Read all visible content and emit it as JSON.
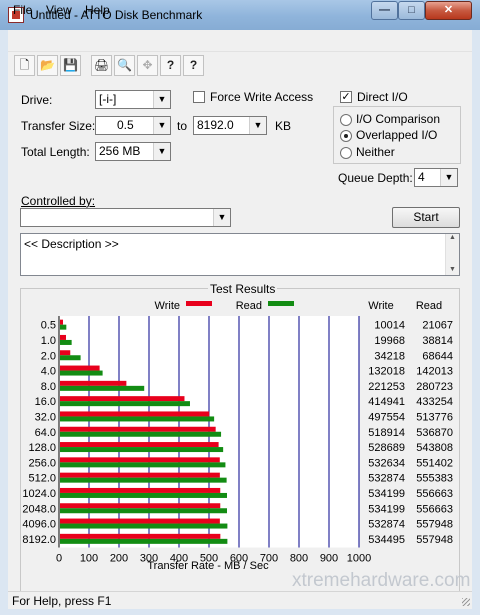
{
  "window": {
    "title": "Untitled - ATTO Disk Benchmark",
    "min": "—",
    "max": "□",
    "close": "✕"
  },
  "menu": [
    "File",
    "View",
    "Help"
  ],
  "toolbar": {
    "icons": [
      "new-document-icon",
      "open-folder-icon",
      "save-icon",
      "print-icon",
      "print-preview-icon",
      "move-icon",
      "help-icon",
      "context-help-icon"
    ],
    "glyphs": [
      "🗋",
      "📂",
      "💾",
      "🖨",
      "🔍",
      "✥",
      "?",
      "?"
    ]
  },
  "settings": {
    "drive_label": "Drive:",
    "drive_value": "[-i-]",
    "transfer_size_label": "Transfer Size:",
    "transfer_from": "0.5",
    "to_label": "to",
    "transfer_to": "8192.0",
    "unit": "KB",
    "total_length_label": "Total Length:",
    "total_length": "256 MB",
    "force_write_access_label": "Force Write Access",
    "force_write_access": false,
    "direct_io_label": "Direct I/O",
    "direct_io": true,
    "io_options": [
      {
        "label": "I/O Comparison",
        "selected": false
      },
      {
        "label": "Overlapped I/O",
        "selected": true
      },
      {
        "label": "Neither",
        "selected": false
      }
    ],
    "queue_depth_label": "Queue Depth:",
    "queue_depth": "4",
    "controlled_by_label": "Controlled by:",
    "controlled_by": "",
    "start_label": "Start",
    "description": "<< Description >>"
  },
  "results": {
    "title": "Test Results",
    "legend_write": "Write",
    "legend_read": "Read",
    "write_header": "Write",
    "read_header": "Read",
    "x_axis_label": "Transfer Rate - MB / Sec"
  },
  "colors": {
    "write": "#e8001c",
    "read": "#138c13",
    "gridline": "#00008b"
  },
  "chart_data": {
    "type": "bar",
    "orientation": "horizontal",
    "title": "Test Results",
    "xlabel": "Transfer Rate - MB / Sec",
    "xlim": [
      0,
      1000
    ],
    "x_ticks": [
      "0",
      "100",
      "200",
      "300",
      "400",
      "500",
      "600",
      "700",
      "800",
      "900",
      "1000"
    ],
    "categories": [
      "0.5",
      "1.0",
      "2.0",
      "4.0",
      "8.0",
      "16.0",
      "32.0",
      "64.0",
      "128.0",
      "256.0",
      "512.0",
      "1024.0",
      "2048.0",
      "4096.0",
      "8192.0"
    ],
    "series": [
      {
        "name": "Write",
        "values": [
          10014,
          19968,
          34218,
          132018,
          221253,
          414941,
          497554,
          518914,
          528689,
          532634,
          532874,
          534199,
          534199,
          532874,
          534495
        ]
      },
      {
        "name": "Read",
        "values": [
          21067,
          38814,
          68644,
          142013,
          280723,
          433254,
          513776,
          536870,
          543808,
          551402,
          555383,
          556663,
          556663,
          557948,
          557948
        ]
      }
    ]
  },
  "status": {
    "text": "For Help, press F1"
  },
  "watermark": "xtremehardware.com"
}
